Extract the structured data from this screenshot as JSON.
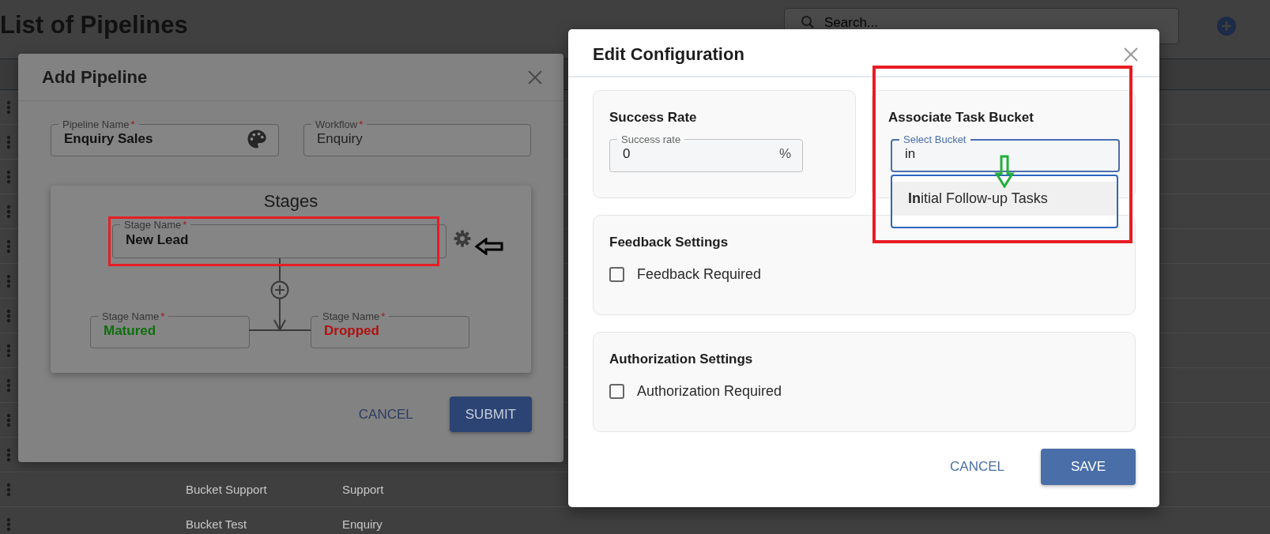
{
  "page": {
    "title": "List of Pipelines",
    "search": {
      "placeholder": "Search..."
    },
    "rows": [
      {},
      {},
      {},
      {},
      {},
      {},
      {},
      {},
      {},
      {},
      {},
      {
        "cells": [
          "Bucket Support",
          "Support"
        ]
      },
      {
        "cells": [
          "Bucket Test",
          "Enquiry"
        ]
      }
    ]
  },
  "add_dialog": {
    "title": "Add Pipeline",
    "fields": [
      {
        "kind": "name",
        "label": "Pipeline Name",
        "mark": "*",
        "value": "Enquiry Sales"
      },
      {
        "kind": "select",
        "label": "Workflow",
        "mark": "*",
        "value": "Enquiry"
      }
    ],
    "stages": {
      "title": "Stages",
      "items": [
        {
          "label": "Stage Name",
          "mark": "*",
          "value": "New Lead",
          "color": "#111111"
        },
        {
          "label": "Stage Name",
          "mark": "*",
          "value": "Matured",
          "color": "#0f6e0f"
        },
        {
          "label": "Stage Name",
          "mark": "*",
          "value": "Dropped",
          "color": "#b01010"
        }
      ]
    },
    "buttons": [
      {
        "kind": "text",
        "label": "CANCEL"
      },
      {
        "kind": "contained",
        "label": "SUBMIT"
      }
    ]
  },
  "edit_dialog": {
    "title": "Edit Configuration",
    "success_rate": {
      "heading": "Success Rate",
      "field": {
        "label": "Success rate",
        "value": "0",
        "suffix": "%"
      }
    },
    "task_bucket": {
      "heading": "Associate Task Bucket",
      "field": {
        "label": "Select Bucket",
        "value": "in",
        "focused": true
      },
      "options": [
        {
          "label": "**In**itial Follow-up Tasks",
          "selected": true
        }
      ]
    },
    "sections": [
      {
        "heading": "Feedback Settings",
        "checkbox": {
          "label": "Feedback Required",
          "checked": false
        }
      },
      {
        "heading": "Authorization Settings",
        "checkbox": {
          "label": "Authorization Required",
          "checked": false
        }
      }
    ],
    "buttons": [
      {
        "kind": "text",
        "label": "CANCEL"
      },
      {
        "kind": "contained",
        "label": "SAVE"
      }
    ]
  }
}
